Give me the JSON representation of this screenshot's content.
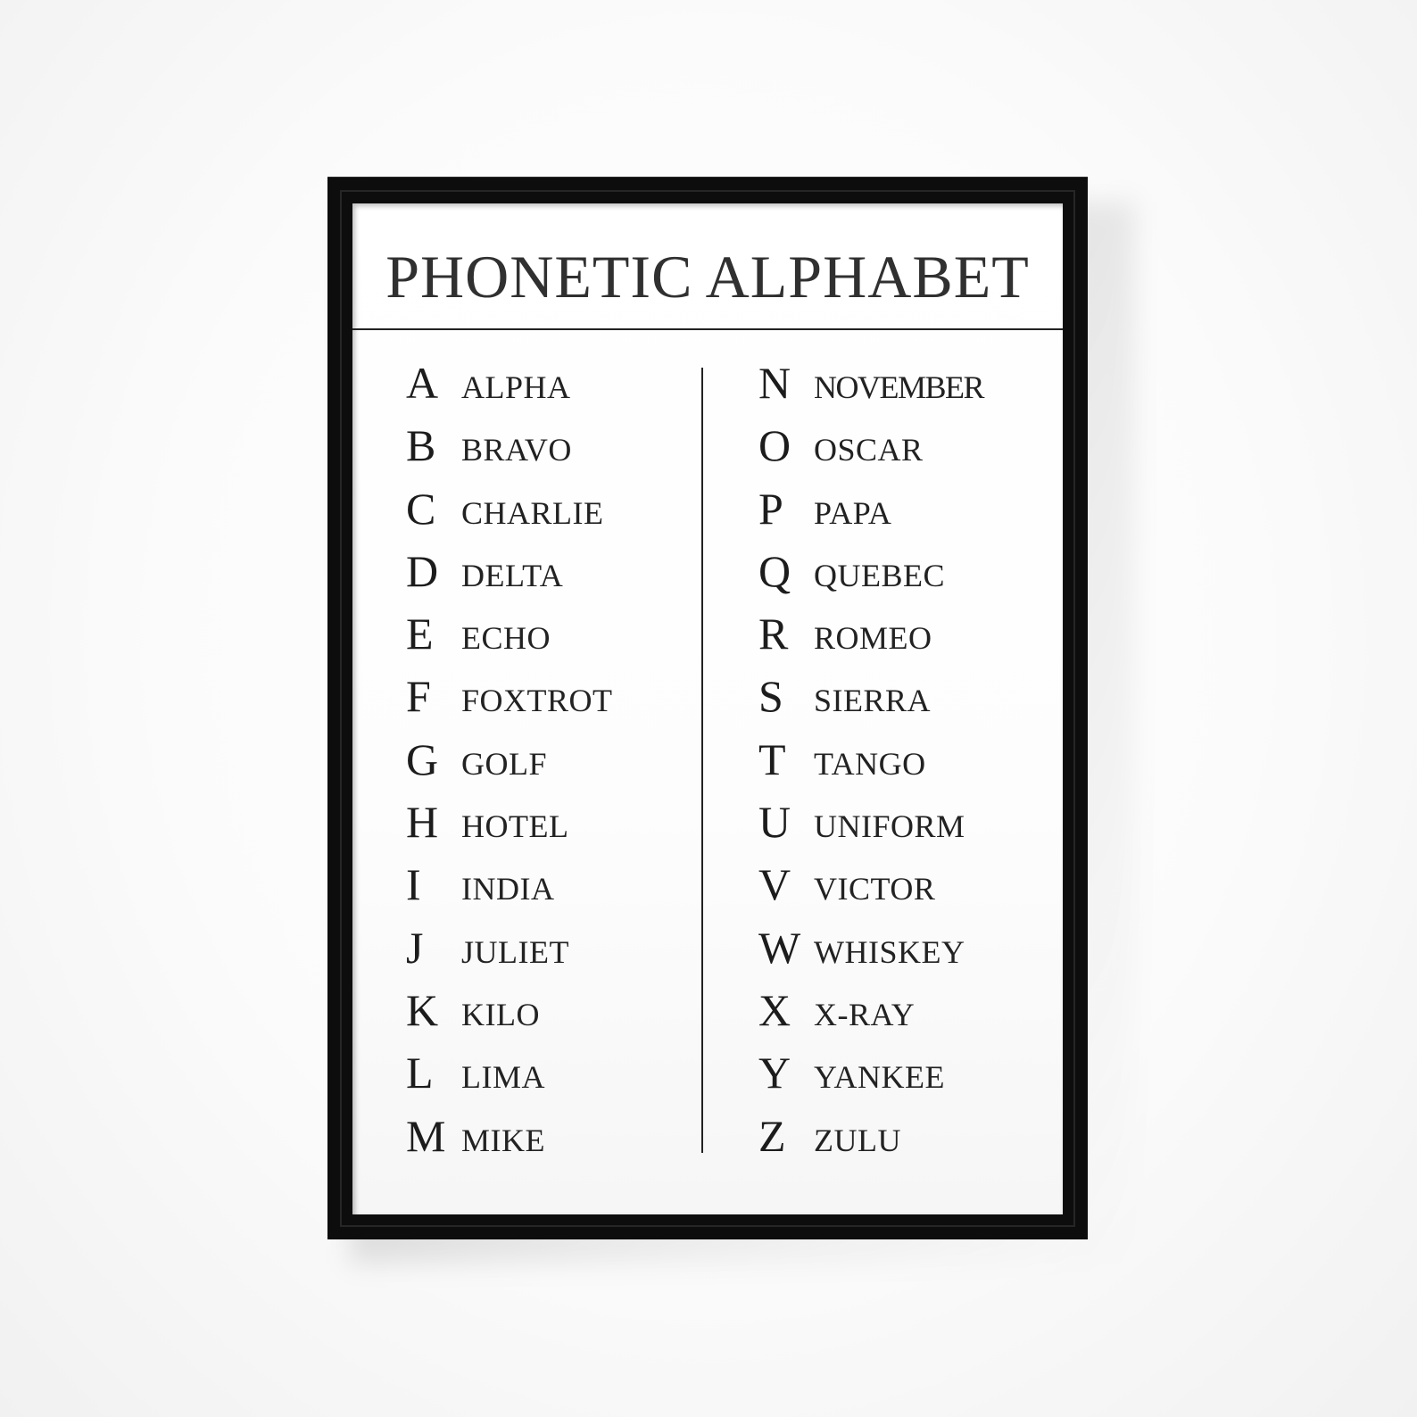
{
  "poster": {
    "title": "PHONETIC ALPHABET",
    "left_column": [
      {
        "letter": "A",
        "word": "ALPHA"
      },
      {
        "letter": "B",
        "word": "BRAVO"
      },
      {
        "letter": "C",
        "word": "CHARLIE"
      },
      {
        "letter": "D",
        "word": "DELTA"
      },
      {
        "letter": "E",
        "word": "ECHO"
      },
      {
        "letter": "F",
        "word": "FOXTROT"
      },
      {
        "letter": "G",
        "word": "GOLF"
      },
      {
        "letter": "H",
        "word": "HOTEL"
      },
      {
        "letter": "I",
        "word": "INDIA"
      },
      {
        "letter": "J",
        "word": "JULIET"
      },
      {
        "letter": "K",
        "word": "KILO"
      },
      {
        "letter": "L",
        "word": "LIMA"
      },
      {
        "letter": "M",
        "word": "MIKE"
      }
    ],
    "right_column": [
      {
        "letter": "N",
        "word": "NOVEMBER"
      },
      {
        "letter": "O",
        "word": "OSCAR"
      },
      {
        "letter": "P",
        "word": "PAPA"
      },
      {
        "letter": "Q",
        "word": "QUEBEC"
      },
      {
        "letter": "R",
        "word": "ROMEO"
      },
      {
        "letter": "S",
        "word": "SIERRA"
      },
      {
        "letter": "T",
        "word": "TANGO"
      },
      {
        "letter": "U",
        "word": "UNIFORM"
      },
      {
        "letter": "V",
        "word": "VICTOR"
      },
      {
        "letter": "W",
        "word": "WHISKEY"
      },
      {
        "letter": "X",
        "word": "X-RAY"
      },
      {
        "letter": "Y",
        "word": "YANKEE"
      },
      {
        "letter": "Z",
        "word": "ZULU"
      }
    ]
  },
  "colors": {
    "frame": "#0d0d0d",
    "paper": "#ffffff",
    "ink": "#222222",
    "wall": "#f7f7f7"
  }
}
